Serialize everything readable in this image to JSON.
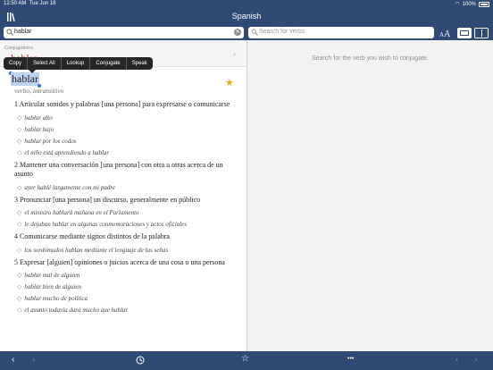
{
  "status": {
    "time": "12:50 AM",
    "date": "Tue Jun 18",
    "battery": "100%"
  },
  "nav": {
    "title": "Spanish"
  },
  "search": {
    "query": "hablar",
    "verb_placeholder": "Search for verbs"
  },
  "toolbar": {
    "aa_small": "A",
    "aa_big": "A"
  },
  "conjugation": {
    "label": "Conjugations",
    "verb": "hablar"
  },
  "context_menu": [
    "Copy",
    "Select All",
    "Lookup",
    "Conjugate",
    "Speak"
  ],
  "entry": {
    "headword": "hablar",
    "pos": "verbo, intransitivo",
    "senses": [
      {
        "text": "1 Articular sonidos y palabras [una persona] para expresarse o comunicarse",
        "examples": [
          "hablar alto",
          "hablar bajo",
          "hablar por los codos",
          "el niño está aprendiendo a hablar"
        ]
      },
      {
        "text": "2 Mantener una conversación [una persona] con otra u otras acerca de un asunto",
        "examples": [
          "ayer hablé largamente con mi padre"
        ]
      },
      {
        "text": "3 Pronunciar [una persona] un discurso, generalmente en público",
        "examples": [
          "el ministro hablará mañana en el Parlamento",
          "le dejaban hablar en algunas conmemoraciones y actos oficiales"
        ]
      },
      {
        "text": "4 Comunicarse mediante signos distintos de la palabra",
        "examples": [
          "los sordomudos hablan mediante el lenguaje de las señas"
        ]
      },
      {
        "text": "5 Expresar [alguien] opiniones o juicios acerca de una cosa o una persona",
        "examples": [
          "hablar mal de alguien",
          "hablar bien de alguien",
          "hablar mucho de política",
          "el asunto todavía dará mucho que hablar"
        ]
      }
    ]
  },
  "right_pane": {
    "hint": "Search for the verb you wish to conjugate."
  },
  "bottom": {
    "more": "•••"
  },
  "colors": {
    "nav": "#2f4a75",
    "star": "#e6a817",
    "verb_red": "#c0392b",
    "selection": "#bcd2f0"
  }
}
